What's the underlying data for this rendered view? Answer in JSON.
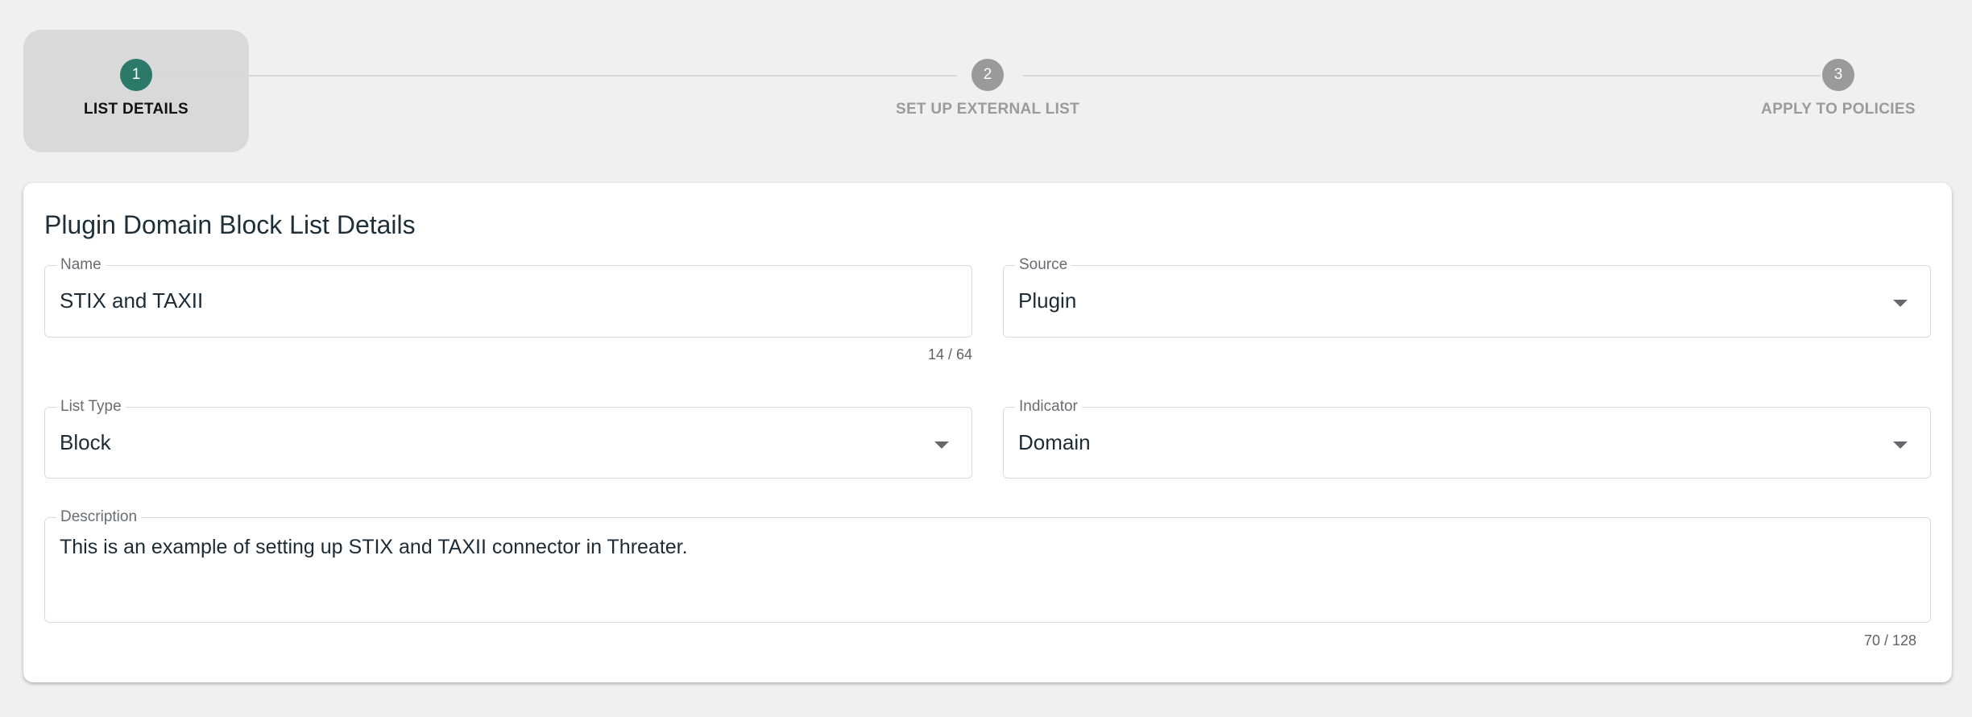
{
  "stepper": {
    "steps": [
      {
        "number": "1",
        "label": "LIST DETAILS",
        "state": "active"
      },
      {
        "number": "2",
        "label": "SET UP EXTERNAL LIST",
        "state": "inactive"
      },
      {
        "number": "3",
        "label": "APPLY TO POLICIES",
        "state": "inactive"
      }
    ]
  },
  "form": {
    "title": "Plugin Domain Block List Details",
    "name": {
      "label": "Name",
      "value": "STIX and TAXII",
      "counter": "14 / 64"
    },
    "source": {
      "label": "Source",
      "value": "Plugin",
      "icon": "chevron-down-icon"
    },
    "list_type": {
      "label": "List Type",
      "value": "Block",
      "icon": "chevron-down-icon"
    },
    "indicator": {
      "label": "Indicator",
      "value": "Domain",
      "icon": "chevron-down-icon"
    },
    "description": {
      "label": "Description",
      "value": "This is an example of setting up STIX and TAXII connector in Threater.",
      "counter": "70 / 128"
    }
  },
  "colors": {
    "accent": "#2b7a69",
    "inactive_step": "#9a9a9a",
    "page_bg": "#eef0f2",
    "card_bg": "#ffffff"
  }
}
